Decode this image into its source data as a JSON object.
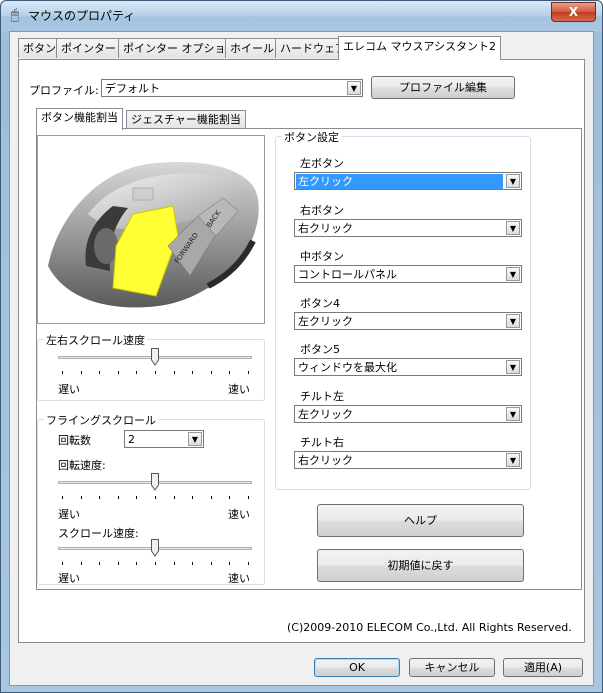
{
  "window": {
    "title": "マウスのプロパティ",
    "close_label": "X"
  },
  "tabs": [
    "ボタン",
    "ポインター",
    "ポインター オプション",
    "ホイール",
    "ハードウェア",
    "エレコム マウスアシスタント2"
  ],
  "profile": {
    "label": "プロファイル:",
    "value": "デフォルト",
    "edit_button": "プロファイル編集"
  },
  "subtabs": [
    "ボタン機能割当",
    "ジェスチャー機能割当"
  ],
  "mouse_image": {
    "forward_label": "FORWARD",
    "back_label": "BACK",
    "highlight_color": "#ffff33"
  },
  "horizontal_scroll": {
    "title": "左右スクロール速度",
    "slow": "遅い",
    "fast": "速い",
    "level": 0.5
  },
  "flying_scroll": {
    "title": "フライングスクロール",
    "rotations_label": "回転数",
    "rotations_value": "2",
    "rotation_speed_label": "回転速度:",
    "rotation_speed_level": 0.5,
    "scroll_speed_label": "スクロール速度:",
    "scroll_speed_level": 0.5,
    "slow": "遅い",
    "fast": "速い"
  },
  "button_settings": {
    "title": "ボタン設定",
    "items": [
      {
        "label": "左ボタン",
        "value": "左クリック",
        "selected": true
      },
      {
        "label": "右ボタン",
        "value": "右クリック"
      },
      {
        "label": "中ボタン",
        "value": "コントロールパネル"
      },
      {
        "label": "ボタン4",
        "value": "左クリック"
      },
      {
        "label": "ボタン5",
        "value": "ウィンドウを最大化"
      },
      {
        "label": "チルト左",
        "value": "左クリック"
      },
      {
        "label": "チルト右",
        "value": "右クリック"
      }
    ]
  },
  "help_button": "ヘルプ",
  "reset_button": "初期値に戻す",
  "copyright": "(C)2009-2010 ELECOM Co.,Ltd. All Rights Reserved.",
  "footer": {
    "ok": "OK",
    "cancel": "キャンセル",
    "apply": "適用(A)"
  },
  "colors": {
    "selection": "#3399ff",
    "title_bar": "#b9d3ea",
    "close_button": "#c13a1f"
  }
}
